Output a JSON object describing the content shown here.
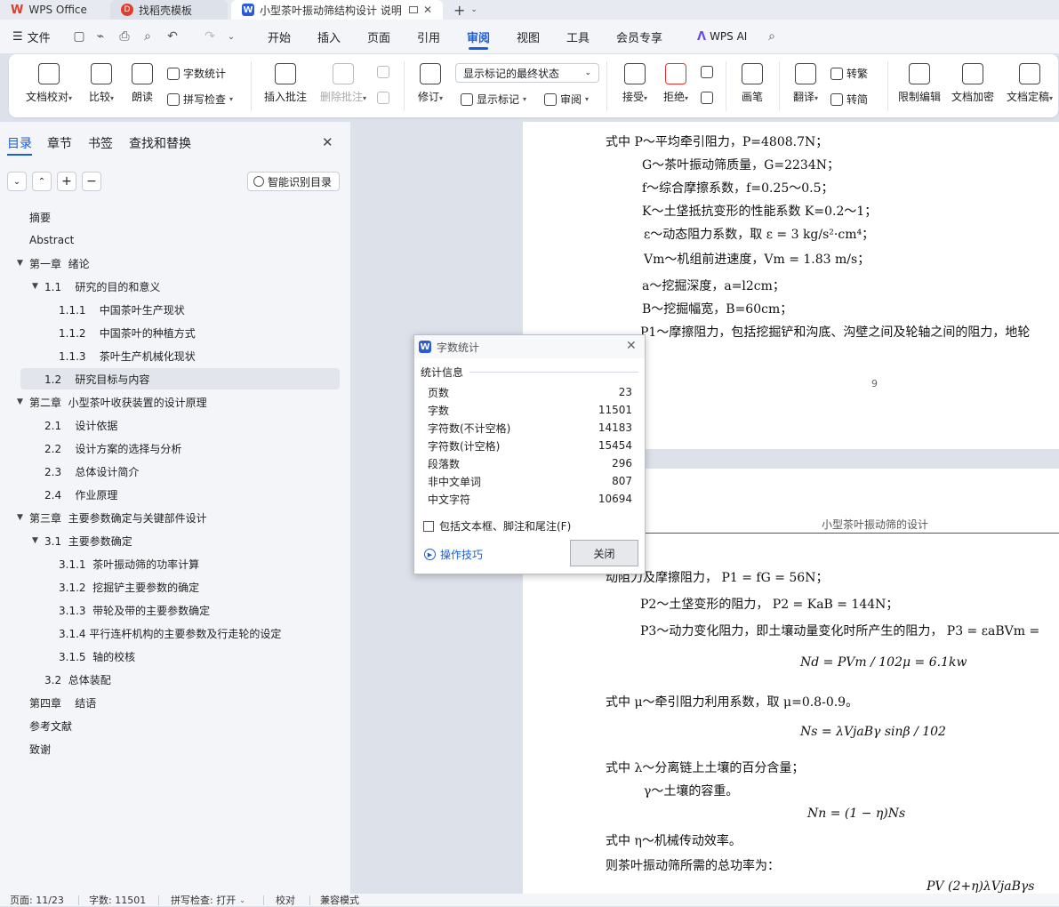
{
  "tabs": [
    {
      "label": "WPS Office"
    },
    {
      "label": "找稻壳模板"
    },
    {
      "label": "小型茶叶振动筛结构设计 说明"
    }
  ],
  "menu": {
    "file": "文件",
    "items": [
      "开始",
      "插入",
      "页面",
      "引用",
      "审阅",
      "视图",
      "工具",
      "会员专享"
    ],
    "active": "审阅",
    "wps_ai": "WPS AI"
  },
  "ribbon": {
    "doc_check": "文档校对",
    "compare": "比较",
    "read_aloud": "朗读",
    "word_count": "字数统计",
    "spell_check": "拼写检查",
    "insert_comment": "插入批注",
    "delete_comment": "删除批注",
    "revise": "修订",
    "markup_select": "显示标记的最终状态",
    "show_markup": "显示标记",
    "review": "审阅",
    "accept": "接受",
    "reject": "拒绝",
    "pen": "画笔",
    "translate": "翻译",
    "to_traditional": "转繁",
    "to_simplified": "转简",
    "restrict_edit": "限制编辑",
    "encrypt": "文档加密",
    "finalize": "文档定稿"
  },
  "sidebar": {
    "tabs": [
      "目录",
      "章节",
      "书签",
      "查找和替换"
    ],
    "smart_toc": "智能识别目录",
    "toc": [
      {
        "label": "摘要",
        "level": 1
      },
      {
        "label": "Abstract",
        "level": 1
      },
      {
        "label": "第一章  绪论",
        "level": 1,
        "expanded": true
      },
      {
        "label": "1.1    研究的目的和意义",
        "level": 2,
        "expanded": true
      },
      {
        "label": "1.1.1    中国茶叶生产现状",
        "level": 3
      },
      {
        "label": "1.1.2    中国茶叶的种植方式",
        "level": 3
      },
      {
        "label": "1.1.3    茶叶生产机械化现状",
        "level": 3
      },
      {
        "label": "1.2    研究目标与内容",
        "level": 2,
        "selected": true
      },
      {
        "label": "第二章  小型茶叶收获装置的设计原理",
        "level": 1,
        "expanded": true
      },
      {
        "label": "2.1    设计依据",
        "level": 2
      },
      {
        "label": "2.2    设计方案的选择与分析",
        "level": 2
      },
      {
        "label": "2.3    总体设计简介",
        "level": 2
      },
      {
        "label": "2.4    作业原理",
        "level": 2
      },
      {
        "label": "第三章  主要参数确定与关键部件设计",
        "level": 1,
        "expanded": true
      },
      {
        "label": "3.1  主要参数确定",
        "level": 2,
        "expanded": true
      },
      {
        "label": "3.1.1  茶叶振动筛的功率计算",
        "level": 3
      },
      {
        "label": "3.1.2  挖掘铲主要参数的确定",
        "level": 3
      },
      {
        "label": "3.1.3  带轮及带的主要参数确定",
        "level": 3
      },
      {
        "label": "3.1.4 平行连杆机构的主要参数及行走轮的设定",
        "level": 3
      },
      {
        "label": "3.1.5  轴的校核",
        "level": 3
      },
      {
        "label": "3.2  总体装配",
        "level": 2
      },
      {
        "label": "第四章    结语",
        "level": 1
      },
      {
        "label": "参考文献",
        "level": 1
      },
      {
        "label": "致谢",
        "level": 1
      }
    ]
  },
  "doc": {
    "page1_lines": [
      "式中  P～平均牵引阻力，P=4808.7N；",
      "G～茶叶振动筛质量，G=2234N；",
      "f～综合摩擦系数，f=0.25～0.5；",
      "K～土垡抵抗变形的性能系数  K=0.2～1；",
      "ε～动态阻力系数，取 ε = 3 kg/s²·cm⁴；",
      "Vm～机组前进速度，Vm = 1.83 m/s；",
      "a～挖掘深度，a=l2cm；",
      "B～挖掘幅宽，B=60cm；",
      "P1～摩擦阻力，包括挖掘铲和沟底、沟壁之间及轮轴之间的阻力，地轮"
    ],
    "page_number": "9",
    "header": "小型茶叶振动筛的设计",
    "page2_lines": [
      "动阻力及摩擦阻力，  P1 = fG = 56N；",
      "P2～土垡变形的阻力，  P2 = KaB = 144N；",
      "P3～动力变化阻力，即土壤动量变化时所产生的阻力，  P3 = εaBVm =",
      "Nd = PVm / 102μ = 6.1kw",
      "式中   μ～牵引阻力利用系数，取 μ=0.8-0.9。",
      "Ns = λVjaBγ sinβ / 102",
      "式中   λ～分离链上土壤的百分含量；",
      "γ～土壤的容重。",
      "Nn = (1 − η)Ns",
      "式中   η～机械传动效率。",
      "则茶叶振动筛所需的总功率为：",
      "PV     (2+η)λVjaBγs"
    ]
  },
  "dialog": {
    "title": "字数统计",
    "section": "统计信息",
    "stats": [
      {
        "label": "页数",
        "value": "23"
      },
      {
        "label": "字数",
        "value": "11501"
      },
      {
        "label": "字符数(不计空格)",
        "value": "14183"
      },
      {
        "label": "字符数(计空格)",
        "value": "15454"
      },
      {
        "label": "段落数",
        "value": "296"
      },
      {
        "label": "非中文单词",
        "value": "807"
      },
      {
        "label": "中文字符",
        "value": "10694"
      }
    ],
    "checkbox": "包括文本框、脚注和尾注(F)",
    "tips": "操作技巧",
    "close": "关闭"
  },
  "status": {
    "page": "页面: 11/23",
    "words": "字数: 11501",
    "spell": "拼写检查: 打开",
    "proof": "校对",
    "compat": "兼容模式"
  }
}
